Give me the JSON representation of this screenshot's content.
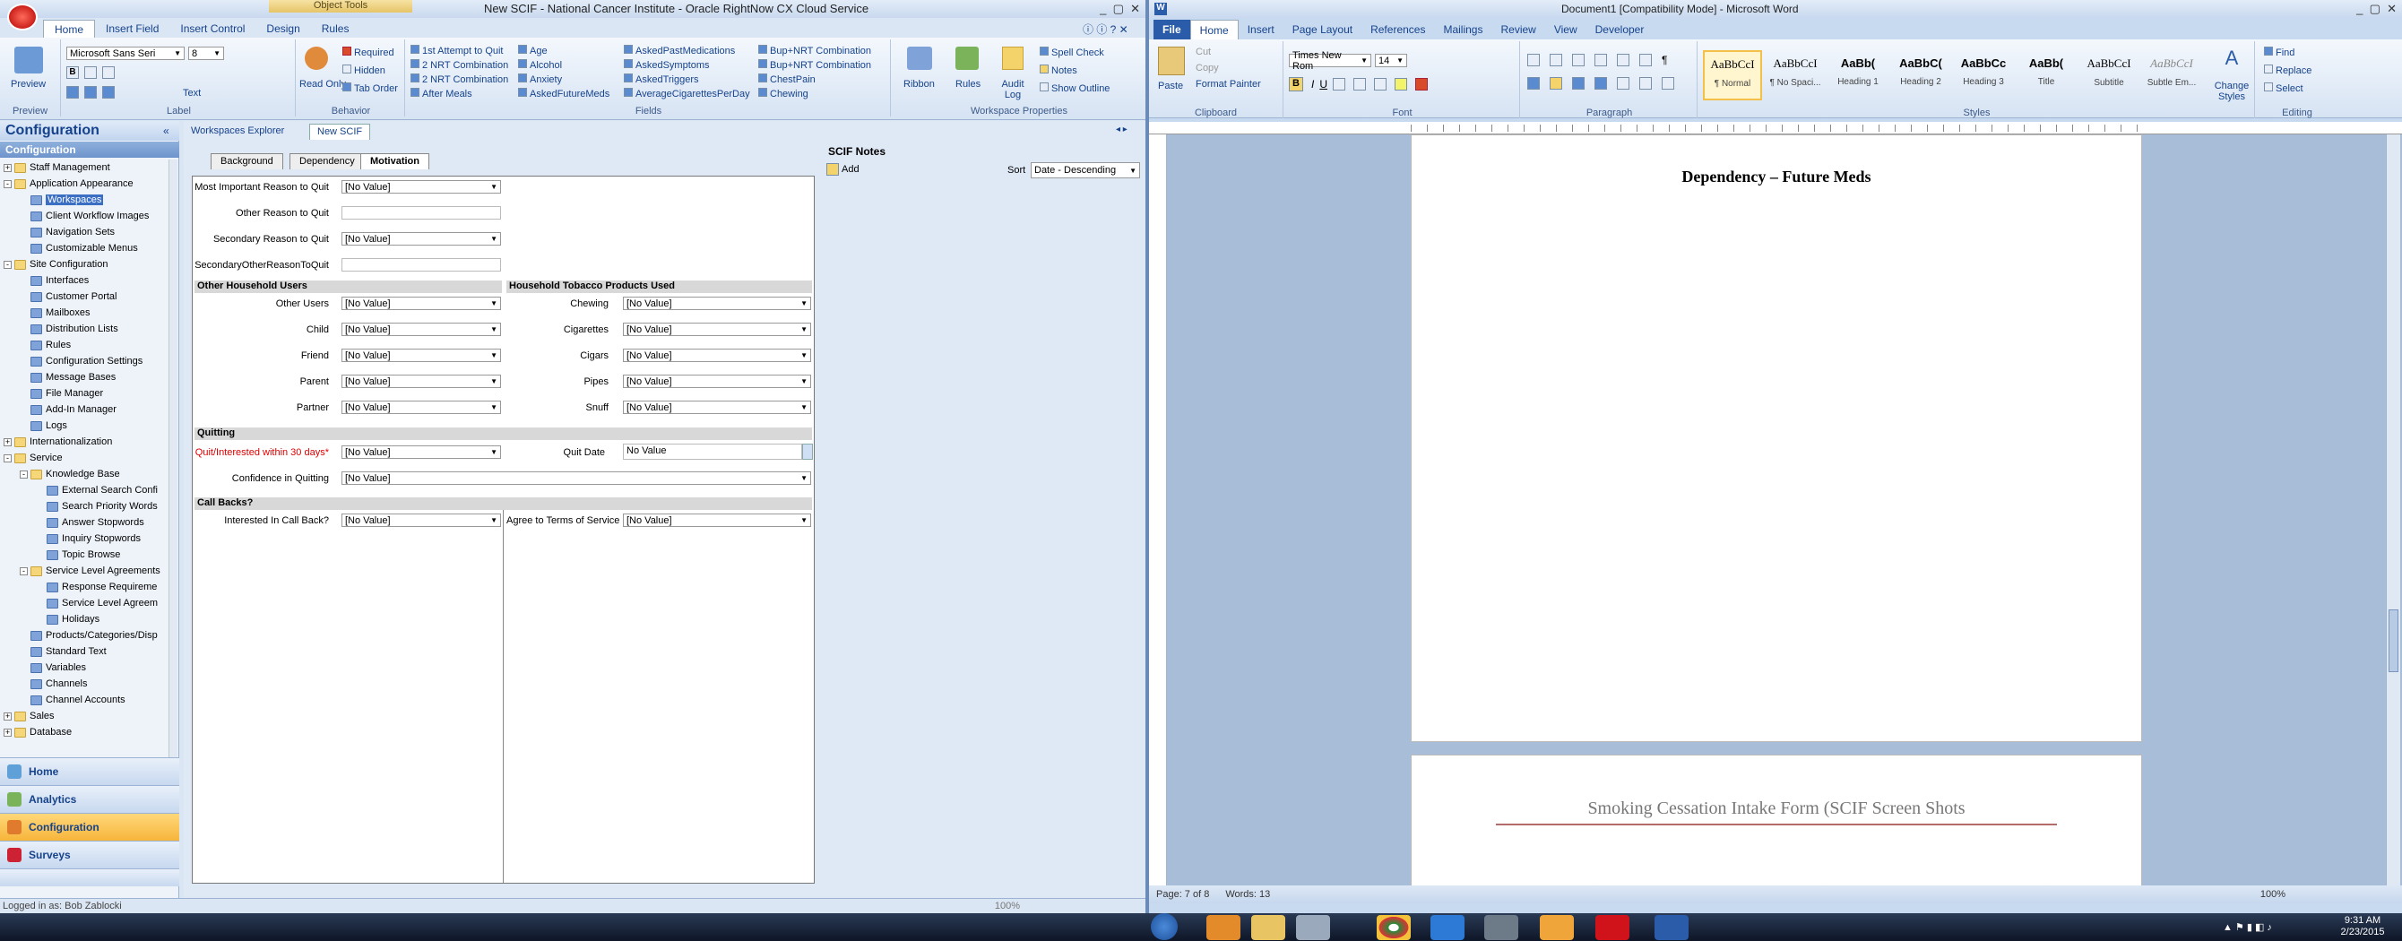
{
  "left_window": {
    "title": "New SCIF - National Cancer Institute - Oracle RightNow CX Cloud Service",
    "context_tools": "Object Tools",
    "tabs": [
      "Home",
      "Insert Field",
      "Insert Control",
      "Design",
      "Rules"
    ],
    "groups": {
      "preview": {
        "label": "Preview",
        "button": "Preview"
      },
      "label": {
        "label": "Label",
        "font": "Microsoft Sans Seri",
        "size": "8",
        "text_button": "Text"
      },
      "behavior": {
        "label": "Behavior",
        "read_only": "Read Only",
        "required": "Required",
        "hidden": "Hidden",
        "tab_order": "Tab Order"
      },
      "fields": {
        "label": "Fields",
        "items": [
          "1st Attempt to Quit",
          "2 NRT Combination",
          "2 NRT Combination",
          "After Meals",
          "Age",
          "Alcohol",
          "Anxiety",
          "AskedFutureMeds",
          "AskedPastMedications",
          "AskedSymptoms",
          "AskedTriggers",
          "AverageCigarettesPerDay",
          "Bup+NRT Combination",
          "Bup+NRT Combination",
          "ChestPain",
          "Chewing"
        ]
      },
      "workspace": {
        "label": "Workspace Properties",
        "ribbon": "Ribbon",
        "rules": "Rules",
        "audit_log": "Audit Log",
        "spell_check": "Spell Check",
        "notes": "Notes",
        "show_outline": "Show Outline"
      }
    },
    "nav": {
      "title": "Configuration",
      "subtitle": "Configuration",
      "tree": [
        {
          "label": "Staff Management",
          "level": 0,
          "exp": "+",
          "type": "fold"
        },
        {
          "label": "Application Appearance",
          "level": 0,
          "exp": "-",
          "type": "fold"
        },
        {
          "label": "Workspaces",
          "level": 1,
          "type": "itm",
          "selected": true
        },
        {
          "label": "Client Workflow Images",
          "level": 1,
          "type": "itm"
        },
        {
          "label": "Navigation Sets",
          "level": 1,
          "type": "itm"
        },
        {
          "label": "Customizable Menus",
          "level": 1,
          "type": "itm"
        },
        {
          "label": "Site Configuration",
          "level": 0,
          "exp": "-",
          "type": "fold"
        },
        {
          "label": "Interfaces",
          "level": 1,
          "type": "itm"
        },
        {
          "label": "Customer Portal",
          "level": 1,
          "type": "itm"
        },
        {
          "label": "Mailboxes",
          "level": 1,
          "type": "itm"
        },
        {
          "label": "Distribution Lists",
          "level": 1,
          "type": "itm"
        },
        {
          "label": "Rules",
          "level": 1,
          "type": "itm"
        },
        {
          "label": "Configuration Settings",
          "level": 1,
          "type": "itm"
        },
        {
          "label": "Message Bases",
          "level": 1,
          "type": "itm"
        },
        {
          "label": "File Manager",
          "level": 1,
          "type": "itm"
        },
        {
          "label": "Add-In Manager",
          "level": 1,
          "type": "itm"
        },
        {
          "label": "Logs",
          "level": 1,
          "type": "itm"
        },
        {
          "label": "Internationalization",
          "level": 0,
          "exp": "+",
          "type": "fold"
        },
        {
          "label": "Service",
          "level": 0,
          "exp": "-",
          "type": "fold"
        },
        {
          "label": "Knowledge Base",
          "level": 1,
          "exp": "-",
          "type": "fold"
        },
        {
          "label": "External Search Confi",
          "level": 2,
          "type": "itm"
        },
        {
          "label": "Search Priority Words",
          "level": 2,
          "type": "itm"
        },
        {
          "label": "Answer Stopwords",
          "level": 2,
          "type": "itm"
        },
        {
          "label": "Inquiry Stopwords",
          "level": 2,
          "type": "itm"
        },
        {
          "label": "Topic Browse",
          "level": 2,
          "type": "itm"
        },
        {
          "label": "Service Level Agreements",
          "level": 1,
          "exp": "-",
          "type": "fold"
        },
        {
          "label": "Response Requireme",
          "level": 2,
          "type": "itm"
        },
        {
          "label": "Service Level Agreem",
          "level": 2,
          "type": "itm"
        },
        {
          "label": "Holidays",
          "level": 2,
          "type": "itm"
        },
        {
          "label": "Products/Categories/Disp",
          "level": 1,
          "type": "itm"
        },
        {
          "label": "Standard Text",
          "level": 1,
          "type": "itm"
        },
        {
          "label": "Variables",
          "level": 1,
          "type": "itm"
        },
        {
          "label": "Channels",
          "level": 1,
          "type": "itm"
        },
        {
          "label": "Channel Accounts",
          "level": 1,
          "type": "itm"
        },
        {
          "label": "Sales",
          "level": 0,
          "exp": "+",
          "type": "fold"
        },
        {
          "label": "Database",
          "level": 0,
          "exp": "+",
          "type": "fold"
        }
      ],
      "buttons": [
        "Home",
        "Analytics",
        "Configuration",
        "Surveys"
      ]
    },
    "doc_tabs": [
      "Workspaces Explorer",
      "New SCIF"
    ],
    "form_tabs": [
      "Background",
      "Dependency",
      "Motivation"
    ],
    "form": {
      "top_rows": [
        {
          "label": "Most Important Reason to Quit",
          "value": "[No Value]",
          "kind": "select"
        },
        {
          "label": "Other Reason to Quit",
          "value": "",
          "kind": "text"
        },
        {
          "label": "Secondary Reason to Quit",
          "value": "[No Value]",
          "kind": "select"
        },
        {
          "label": "SecondaryOtherReasonToQuit",
          "value": "",
          "kind": "text"
        }
      ],
      "sec_household": "Other Household Users",
      "sec_tobacco": "Household Tobacco Products Used",
      "household": [
        {
          "label": "Other Users",
          "value": "[No Value]"
        },
        {
          "label": "Child",
          "value": "[No Value]"
        },
        {
          "label": "Friend",
          "value": "[No Value]"
        },
        {
          "label": "Parent",
          "value": "[No Value]"
        },
        {
          "label": "Partner",
          "value": "[No Value]"
        }
      ],
      "tobacco": [
        {
          "label": "Chewing",
          "value": "[No Value]"
        },
        {
          "label": "Cigarettes",
          "value": "[No Value]"
        },
        {
          "label": "Cigars",
          "value": "[No Value]"
        },
        {
          "label": "Pipes",
          "value": "[No Value]"
        },
        {
          "label": "Snuff",
          "value": "[No Value]"
        }
      ],
      "sec_quitting": "Quitting",
      "quit_interest": {
        "label": "Quit/Interested within 30 days*",
        "value": "[No Value]"
      },
      "quit_date": {
        "label": "Quit Date",
        "value": "No Value"
      },
      "confidence": {
        "label": "Confidence in Quitting",
        "value": "[No Value]"
      },
      "sec_callbacks": "Call Backs?",
      "callback": {
        "label": "Interested In Call Back?",
        "value": "[No Value]"
      },
      "agree": {
        "label": "Agree to Terms of Service",
        "value": "[No Value]"
      }
    },
    "notes": {
      "title": "SCIF Notes",
      "add": "Add",
      "sort_label": "Sort",
      "sort_value": "Date - Descending"
    },
    "status": "Logged in as: Bob Zablocki",
    "zoom": "100%",
    "accent": "#f7b53b"
  },
  "right_window": {
    "title": "Document1 [Compatibility Mode] - Microsoft Word",
    "tabs": [
      "File",
      "Home",
      "Insert",
      "Page Layout",
      "References",
      "Mailings",
      "Review",
      "View",
      "Developer"
    ],
    "clipboard": {
      "label": "Clipboard",
      "paste": "Paste",
      "cut": "Cut",
      "copy": "Copy",
      "format_painter": "Format Painter"
    },
    "font": {
      "label": "Font",
      "name": "Times New Rom",
      "size": "14"
    },
    "paragraph_label": "Paragraph",
    "styles_label": "Styles",
    "styles": [
      {
        "sample": "AaBbCcI",
        "name": "¶ Normal"
      },
      {
        "sample": "AaBbCcI",
        "name": "¶ No Spaci..."
      },
      {
        "sample": "AaBb(",
        "name": "Heading 1"
      },
      {
        "sample": "AaBbC(",
        "name": "Heading 2"
      },
      {
        "sample": "AaBbCc",
        "name": "Heading 3"
      },
      {
        "sample": "AaBb(",
        "name": "Title"
      },
      {
        "sample": "AaBbCcI",
        "name": "Subtitle"
      },
      {
        "sample": "AaBbCcI",
        "name": "Subtle Em..."
      }
    ],
    "change_styles": "Change Styles",
    "editing": {
      "label": "Editing",
      "find": "Find",
      "replace": "Replace",
      "select": "Select"
    },
    "doc": {
      "heading": "Dependency – Future Meds",
      "page2_header": "Smoking Cessation Intake Form (SCIF Screen Shots"
    },
    "status": {
      "page": "Page: 7 of 8",
      "words": "Words: 13",
      "zoom": "100%"
    }
  },
  "taskbar": {
    "time": "9:31 AM",
    "date": "2/23/2015"
  }
}
